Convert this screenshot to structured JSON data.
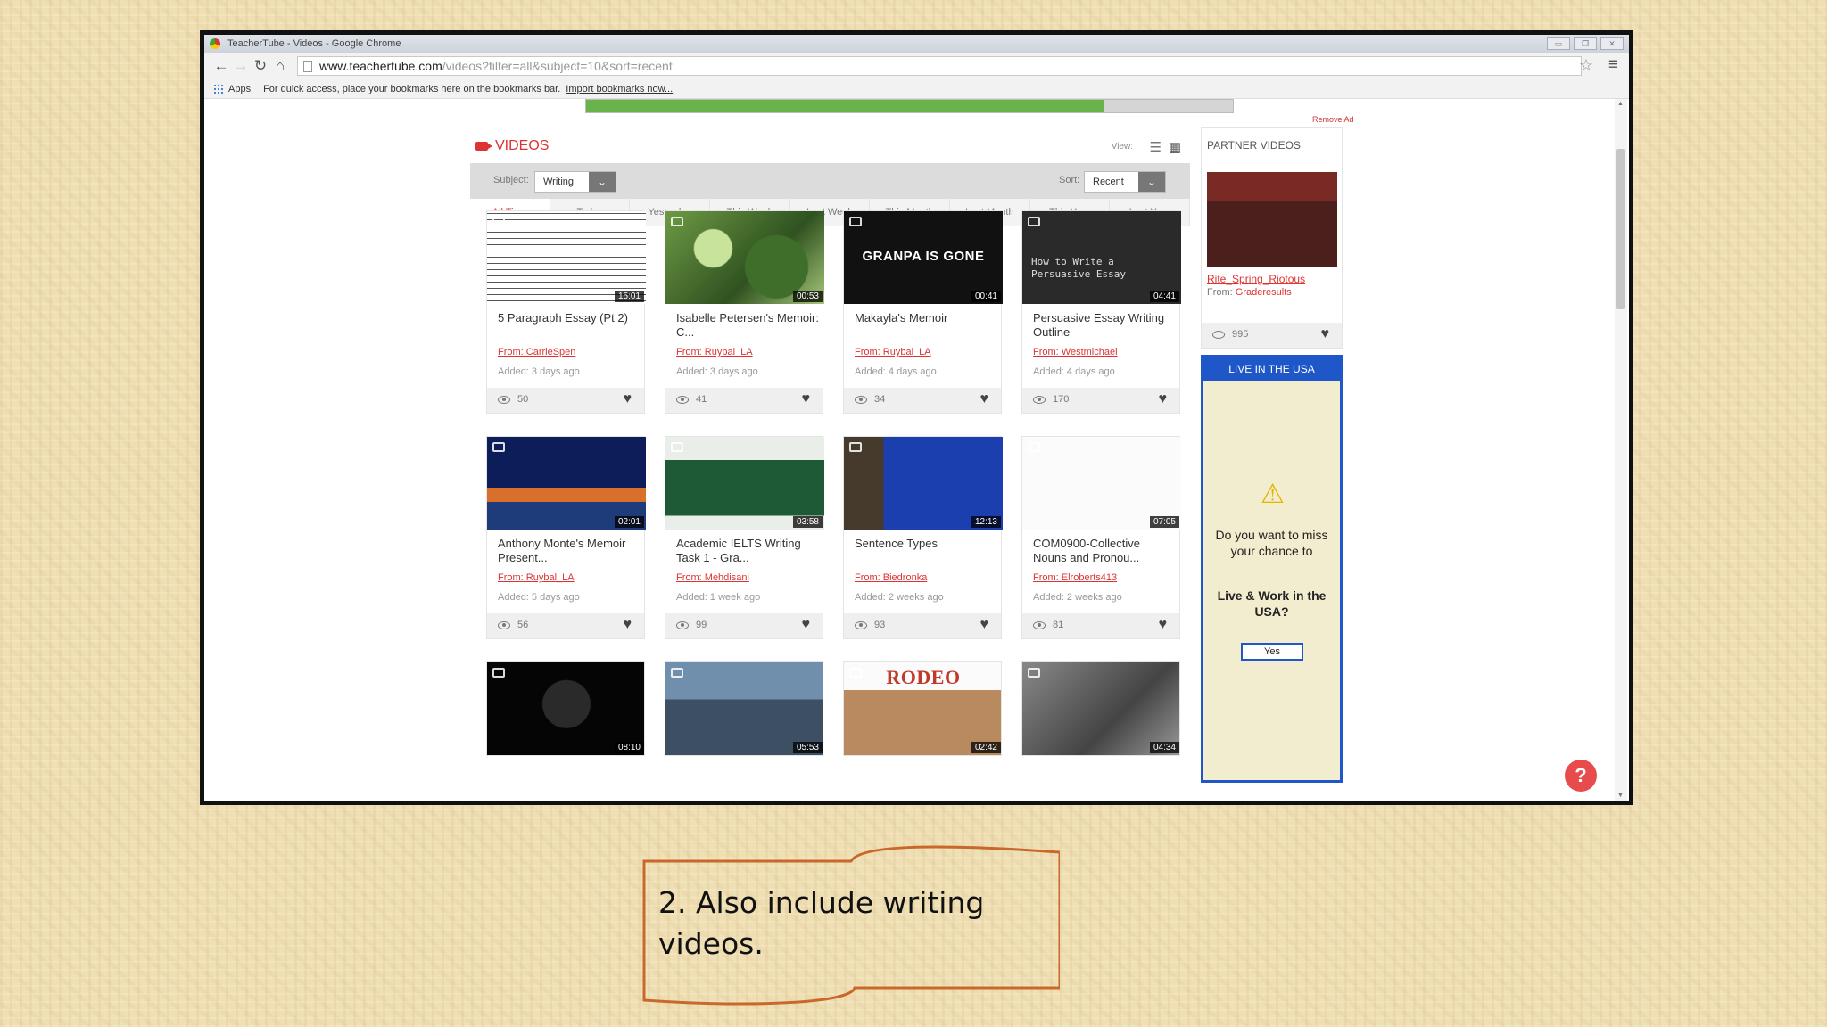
{
  "browser": {
    "window_title": "TeacherTube - Videos - Google Chrome",
    "url_host": "www.teachertube.com",
    "url_path": "/videos?filter=all&subject=10&sort=recent",
    "bookmarks_apps": "Apps",
    "bookmarks_hint": "For quick access, place your bookmarks here on the bookmarks bar.",
    "bookmarks_import": "Import bookmarks now...",
    "page_load_progress": 0.8,
    "icons": [
      "back-icon",
      "forward-icon",
      "reload-icon",
      "home-icon",
      "page-icon",
      "star-icon",
      "menu-icon"
    ]
  },
  "page": {
    "remove_ad": "Remove Ad",
    "section_title": "VIDEOS",
    "view_label": "View:",
    "subject_label": "Subject:",
    "subject_value": "Writing",
    "sort_label": "Sort:",
    "sort_value": "Recent",
    "time_tabs": [
      "All Time",
      "Today",
      "Yesterday",
      "This Week",
      "Last Week",
      "This Month",
      "Last Month",
      "This Year",
      "Last Year"
    ],
    "active_tab": "All Time",
    "accent_color": "#dd3333"
  },
  "videos": [
    {
      "title": "5 Paragraph Essay (Pt 2)",
      "from": "From: CarrieSpen",
      "added": "Added: 3 days ago",
      "views": "50",
      "duration": "15:01"
    },
    {
      "title": "Isabelle Petersen's Memoir: C...",
      "from": "From: Ruybal_LA",
      "added": "Added: 3 days ago",
      "views": "41",
      "duration": "00:53"
    },
    {
      "title": "Makayla's Memoir",
      "from": "From: Ruybal_LA",
      "added": "Added: 4 days ago",
      "views": "34",
      "duration": "00:41",
      "thumb_text": "GRANPA IS GONE"
    },
    {
      "title": "Persuasive Essay Writing Outline",
      "from": "From: Westmichael",
      "added": "Added: 4 days ago",
      "views": "170",
      "duration": "04:41",
      "thumb_text": "How to Write a\nPersuasive Essay"
    },
    {
      "title": "Anthony Monte's Memoir Present...",
      "from": "From: Ruybal_LA",
      "added": "Added: 5 days ago",
      "views": "56",
      "duration": "02:01"
    },
    {
      "title": "Academic IELTS Writing Task 1 - Gra...",
      "from": "From: Mehdisani",
      "added": "Added: 1 week ago",
      "views": "99",
      "duration": "03:58"
    },
    {
      "title": "Sentence Types",
      "from": "From: Biedronka",
      "added": "Added: 2 weeks ago",
      "views": "93",
      "duration": "12:13"
    },
    {
      "title": "COM0900-Collective Nouns and Pronou...",
      "from": "From: Elroberts413",
      "added": "Added: 2 weeks ago",
      "views": "81",
      "duration": "07:05"
    },
    {
      "duration": "08:10"
    },
    {
      "duration": "05:53"
    },
    {
      "duration": "02:42",
      "thumb_text": "RODEO"
    },
    {
      "duration": "04:34"
    }
  ],
  "partner": {
    "title": "PARTNER VIDEOS",
    "video_title": "Rite_Spring_Riotous",
    "from_label": "From:",
    "from_user": "Graderesults",
    "views": "995"
  },
  "ad": {
    "header": "LIVE IN THE USA",
    "question1": "Do you want to miss your chance to",
    "question2": "Live & Work in the USA?",
    "button": "Yes"
  },
  "help_label": "?",
  "callout_text": "2. Also include writing videos."
}
